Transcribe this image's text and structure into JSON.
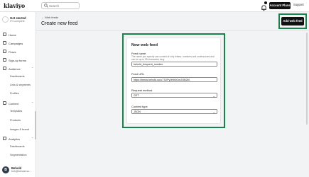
{
  "topbar": {
    "logo": "klaviyo",
    "search_placeholder": "Search",
    "account_button": "Account Plans",
    "support": "Support"
  },
  "sidebar": {
    "getting_started": {
      "title": "Get started",
      "progress": "0% complete"
    },
    "items": [
      {
        "label": "Home",
        "icon": "home-icon"
      },
      {
        "label": "Campaigns",
        "icon": "megaphone-icon"
      },
      {
        "label": "Flows",
        "icon": "flow-icon"
      },
      {
        "label": "Sign-up forms",
        "icon": "form-icon"
      },
      {
        "label": "Audience",
        "icon": "people-icon",
        "expanded": true,
        "children": [
          "Dashboards",
          "Lists & segments",
          "Profiles"
        ]
      },
      {
        "label": "Content",
        "icon": "content-icon",
        "expanded": true,
        "children": [
          "Templates",
          "Products",
          "Images & brand"
        ]
      },
      {
        "label": "Analytics",
        "icon": "chart-icon",
        "expanded": true,
        "children": [
          "Dashboards",
          "Segmentation"
        ]
      }
    ],
    "user": {
      "initial": "B",
      "name": "Behold",
      "email": "beh@behold.so..."
    }
  },
  "header": {
    "back_label": "← Web feeds",
    "title": "Create new feed",
    "add_button": "Add web feed"
  },
  "form": {
    "title": "New web feed",
    "feed_name_label": "Feed name",
    "feed_name_hint": "The name you specify can consist of only letters, numbers and underscores and can be up to 55 characters long.",
    "feed_name_value": "behold_frequent_number",
    "feed_url_label": "Feed URL",
    "feed_url_value": "https://feeds.behold.so/u77l2Py0HIt0Gm2OB2M",
    "method_label": "Request method",
    "method_value": "GET",
    "content_type_label": "Content type",
    "content_type_value": "JSON"
  },
  "colors": {
    "highlight": "#17834a",
    "dark_button": "#111111"
  }
}
